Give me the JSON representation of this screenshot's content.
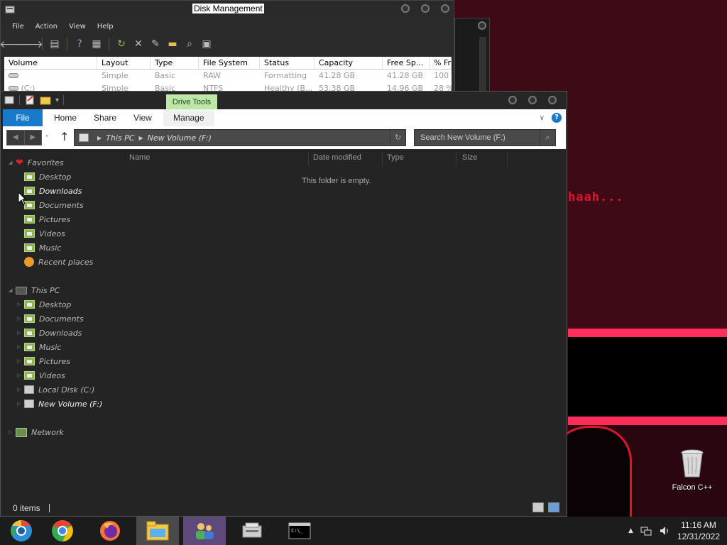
{
  "desktop": {
    "wallpaper_text": "haah...",
    "icons": [
      {
        "label": "Falcon C++",
        "icon": "recycle-bin-icon"
      }
    ]
  },
  "disk_mgmt": {
    "title": "Disk Management",
    "menu": [
      "File",
      "Action",
      "View",
      "Help"
    ],
    "columns": [
      "Volume",
      "Layout",
      "Type",
      "File System",
      "Status",
      "Capacity",
      "Free Sp...",
      "% Fr"
    ],
    "rows": [
      {
        "volume": "",
        "layout": "Simple",
        "type": "Basic",
        "fs": "RAW",
        "status": "Formatting",
        "capacity": "41.28 GB",
        "free": "41.28 GB",
        "pct": "100 %"
      },
      {
        "volume": "(C:)",
        "layout": "Simple",
        "type": "Basic",
        "fs": "NTFS",
        "status": "Healthy (B...",
        "capacity": "53.38 GB",
        "free": "14.96 GB",
        "pct": "28 %"
      }
    ]
  },
  "explorer": {
    "contextual_tab": "Drive Tools",
    "ribbon_tabs": {
      "file": "File",
      "home": "Home",
      "share": "Share",
      "view": "View",
      "manage": "Manage"
    },
    "breadcrumb": [
      "This PC",
      "New Volume (F:)"
    ],
    "search_placeholder": "Search New Volume (F:)",
    "columns": {
      "name": "Name",
      "date": "Date modified",
      "type": "Type",
      "size": "Size"
    },
    "empty_message": "This folder is empty.",
    "status": "0 items",
    "nav": {
      "favorites": {
        "label": "Favorites",
        "items": [
          "Desktop",
          "Downloads",
          "Documents",
          "Pictures",
          "Videos",
          "Music",
          "Recent places"
        ]
      },
      "this_pc": {
        "label": "This PC",
        "items": [
          "Desktop",
          "Documents",
          "Downloads",
          "Music",
          "Pictures",
          "Videos",
          "Local Disk (C:)",
          "New Volume (F:)"
        ]
      },
      "network": {
        "label": "Network"
      }
    }
  },
  "taskbar": {
    "apps": [
      "chrome-beta-icon",
      "chrome-icon",
      "firefox-icon",
      "file-explorer-icon",
      "users-icon",
      "disk-management-icon",
      "command-prompt-icon"
    ],
    "time": "11:16 AM",
    "date": "12/31/2022"
  }
}
